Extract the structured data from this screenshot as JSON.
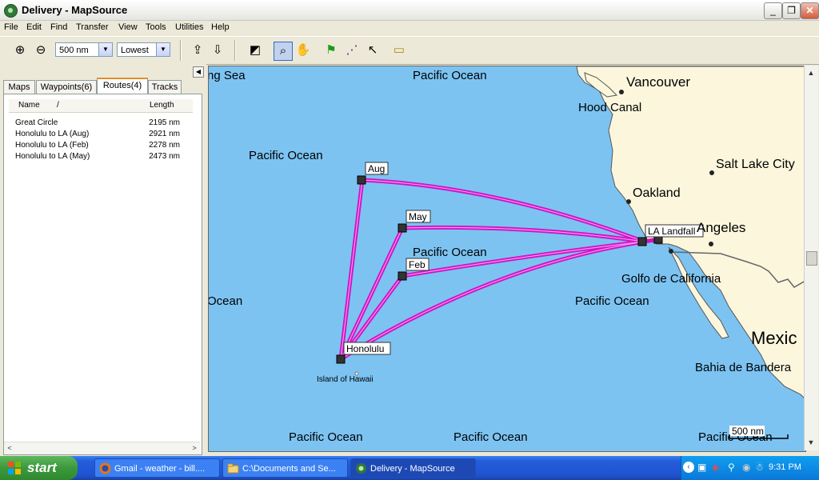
{
  "window": {
    "title": "Delivery - MapSource"
  },
  "menu": [
    "File",
    "Edit",
    "Find",
    "Transfer",
    "View",
    "Tools",
    "Utilities",
    "Help"
  ],
  "toolbar": {
    "zoom_value": "500 nm",
    "detail_value": "Lowest"
  },
  "tabs": [
    {
      "label": "Maps"
    },
    {
      "label": "Waypoints(6)"
    },
    {
      "label": "Routes(4)"
    },
    {
      "label": "Tracks"
    }
  ],
  "list": {
    "col_name": "Name",
    "sort_indicator": "/",
    "col_length": "Length",
    "rows": [
      {
        "name": "Great Circle",
        "length": "2195 nm"
      },
      {
        "name": "Honolulu to LA (Aug)",
        "length": "2921 nm"
      },
      {
        "name": "Honolulu to LA (Feb)",
        "length": "2278 nm"
      },
      {
        "name": "Honolulu to LA (May)",
        "length": "2473 nm"
      }
    ]
  },
  "map": {
    "labels": {
      "bering": "ng Sea",
      "pacific_top": "Pacific Ocean",
      "vancouver": "Vancouver",
      "hood_canal": "Hood Canal",
      "pacific_left": "Pacific Ocean",
      "salt_lake": "Salt Lake City",
      "oakland": "Oakland",
      "angeles": "Angeles",
      "pacific_mid": "Pacific Ocean",
      "golfo": "Golfo de California",
      "ocean_left": "Ocean",
      "pacific_right": "Pacific Ocean",
      "mexico": "Mexic",
      "bahia": "Bahia de Bandera",
      "island_hawaii": "Island of Hawaii",
      "pacific_bl": "Pacific Ocean",
      "pacific_bc": "Pacific Ocean",
      "pacific_br": "Pacific Ocean"
    },
    "waypoints": {
      "aug": "Aug",
      "may": "May",
      "feb": "Feb",
      "honolulu": "Honolulu",
      "la": "LA Landfall"
    },
    "scale": "500 nm",
    "colors": {
      "water": "#7cc3f2",
      "land": "#fbf6dc",
      "route": "#cc16c4"
    }
  },
  "taskbar": {
    "start": "start",
    "tasks": [
      {
        "label": "Gmail - weather - bill...."
      },
      {
        "label": "C:\\Documents and Se..."
      },
      {
        "label": "Delivery - MapSource"
      }
    ],
    "clock": "9:31 PM"
  }
}
